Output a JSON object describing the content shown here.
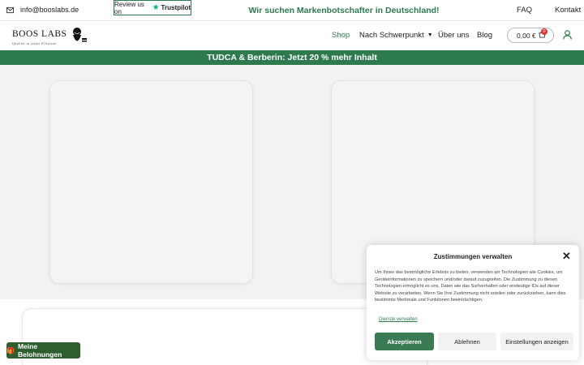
{
  "topbar": {
    "email": "info@booslabs.de",
    "trustpilot_prefix": "Review us on",
    "trustpilot_brand": "Trustpilot",
    "promo": "Wir suchen Markenbotschafter in Deutschland!",
    "faq": "FAQ",
    "contact": "Kontakt"
  },
  "header": {
    "logo_text": "BOOS LABS",
    "logo_sub": "Qualität in seiner Effizienz",
    "nav": {
      "shop": "Shop",
      "schwerpunkt": "Nach Schwerpunkt",
      "ueber": "Über uns",
      "blog": "Blog"
    },
    "cart_total": "0,00 €",
    "cart_count": "0"
  },
  "strip": {
    "text": "TUDCA & Berberin: Jetzt 20 % mehr Inhalt"
  },
  "rewards": {
    "label": "Meine Belohnungen"
  },
  "consent": {
    "title": "Zustimmungen verwalten",
    "body": "Um Ihnen das bestmögliche Erlebnis zu bieten, verwenden wir Technologien wie Cookies, um Geräteinformationen zu speichern und/oder darauf zuzugreifen. Die Zustimmung zu diesen Technologien ermöglicht es uns, Daten wie das Surfverhalten oder eindeutige IDs auf dieser Website zu verarbeiten. Wenn Sie Ihre Zustimmung nicht erteilen oder zurückziehen, kann dies bestimmte Merkmale und Funktionen beeinträchtigen.",
    "services_link": "Dienste verwalten",
    "accept": "Akzeptieren",
    "decline": "Ablehnen",
    "settings": "Einstellungen anzeigen"
  },
  "colors": {
    "brand_green": "#2e7a4f",
    "rewards_green": "#2e5e2e",
    "accept_green": "#3a7a55"
  },
  "icons": [
    "mail-icon",
    "trustpilot-star-icon",
    "chevron-down-icon",
    "cart-icon",
    "account-icon",
    "gift-icon",
    "close-icon"
  ]
}
